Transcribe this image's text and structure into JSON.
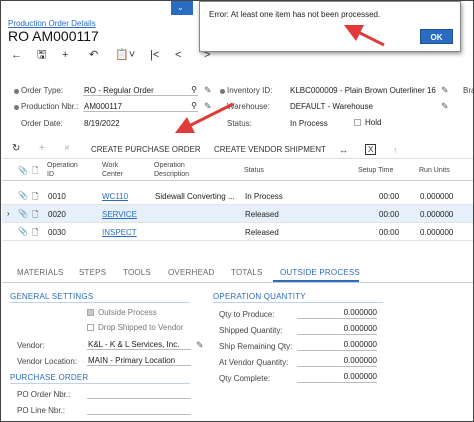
{
  "breadcrumb": "Production Order Details",
  "page_title": "RO AM000117",
  "dialog": {
    "message": "Error: At least one item has not been processed.",
    "ok_label": "OK"
  },
  "header": {
    "order_type_label": "Order Type:",
    "order_type_value": "RO - Regular Order",
    "production_nbr_label": "Production Nbr.:",
    "production_nbr_value": "AM000117",
    "order_date_label": "Order Date:",
    "order_date_value": "8/19/2022",
    "inventory_id_label": "Inventory ID:",
    "inventory_id_value": "KLBC000009 - Plain Brown Outerliner 16",
    "warehouse_label": "Warehouse:",
    "warehouse_value": "DEFAULT - Warehouse",
    "status_label": "Status:",
    "status_value": "In Process",
    "hold_label": "Hold",
    "truncated_label": "Bra"
  },
  "grid_toolbar": {
    "create_purchase_order": "CREATE PURCHASE ORDER",
    "create_vendor_shipment": "CREATE VENDOR SHIPMENT"
  },
  "grid": {
    "columns": {
      "operation_id": "Operation\nID",
      "work_center": "Work\nCenter",
      "operation_description": "Operation\nDescription",
      "status": "Status",
      "setup_time": "Setup Time",
      "run_units": "Run Units"
    },
    "rows": [
      {
        "operation_id": "0010",
        "work_center": "WC110",
        "description": "Sidewall Converting ...",
        "status": "In Process",
        "setup_time": "00:00",
        "run_units": "0.000000"
      },
      {
        "operation_id": "0020",
        "work_center": "SERVICE",
        "description": "",
        "status": "Released",
        "setup_time": "00:00",
        "run_units": "0.000000"
      },
      {
        "operation_id": "0030",
        "work_center": "INSPECT",
        "description": "",
        "status": "Released",
        "setup_time": "00:00",
        "run_units": "0.000000"
      }
    ]
  },
  "tabs": [
    "MATERIALS",
    "STEPS",
    "TOOLS",
    "OVERHEAD",
    "TOTALS",
    "OUTSIDE PROCESS"
  ],
  "general_settings": {
    "title": "GENERAL SETTINGS",
    "outside_process_label": "Outside Process",
    "drop_shipped_label": "Drop Shipped to Vendor",
    "vendor_label": "Vendor:",
    "vendor_value": "K&L - K & L Services, Inc.",
    "vendor_location_label": "Vendor Location:",
    "vendor_location_value": "MAIN - Primary Location"
  },
  "purchase_order": {
    "title": "PURCHASE ORDER",
    "po_order_nbr_label": "PO Order Nbr.:",
    "po_line_nbr_label": "PO Line Nbr.:"
  },
  "operation_quantity": {
    "title": "OPERATION QUANTITY",
    "qty_to_produce_label": "Qty to Produce:",
    "qty_to_produce_value": "0.000000",
    "shipped_quantity_label": "Shipped Quantity:",
    "shipped_quantity_value": "0.000000",
    "ship_remaining_label": "Ship Remaining Qty:",
    "ship_remaining_value": "0.000000",
    "at_vendor_label": "At Vendor Quantity:",
    "at_vendor_value": "0.000000",
    "qty_complete_label": "Qty Complete:",
    "qty_complete_value": "0.000000"
  },
  "colors": {
    "accent": "#2a6cc2",
    "arrow": "#e03a3a",
    "selected_row": "#e6f0fa"
  }
}
